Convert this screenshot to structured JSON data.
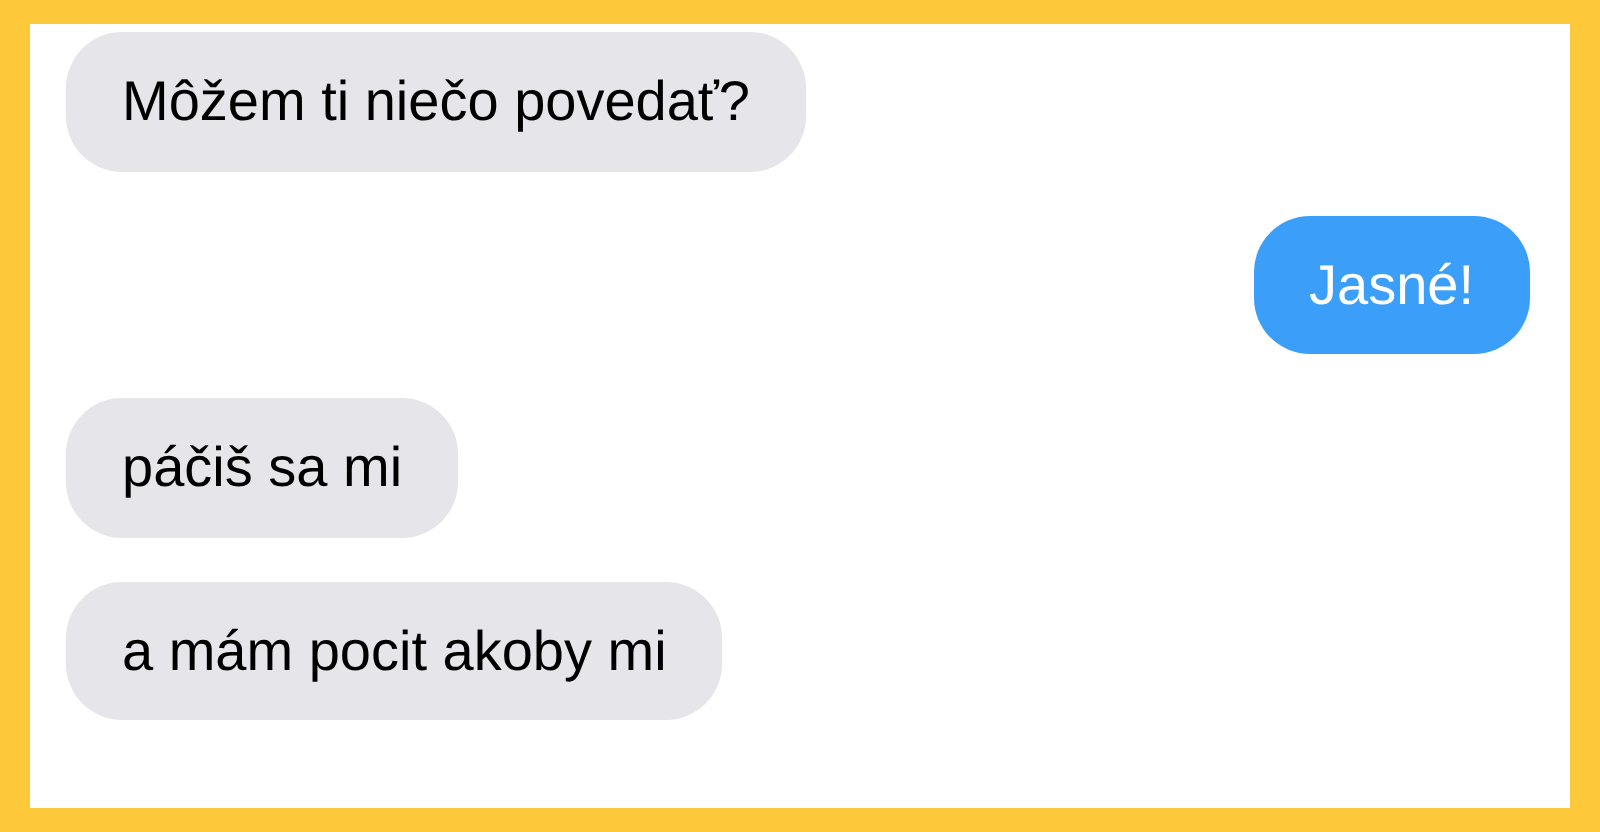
{
  "messages": [
    {
      "kind": "received",
      "text": "Môžem ti niečo povedať?"
    },
    {
      "kind": "sent",
      "text": "Jasné!"
    },
    {
      "kind": "received",
      "text": "páčiš sa mi"
    },
    {
      "kind": "received",
      "text": "a mám pocit akoby mi"
    }
  ]
}
